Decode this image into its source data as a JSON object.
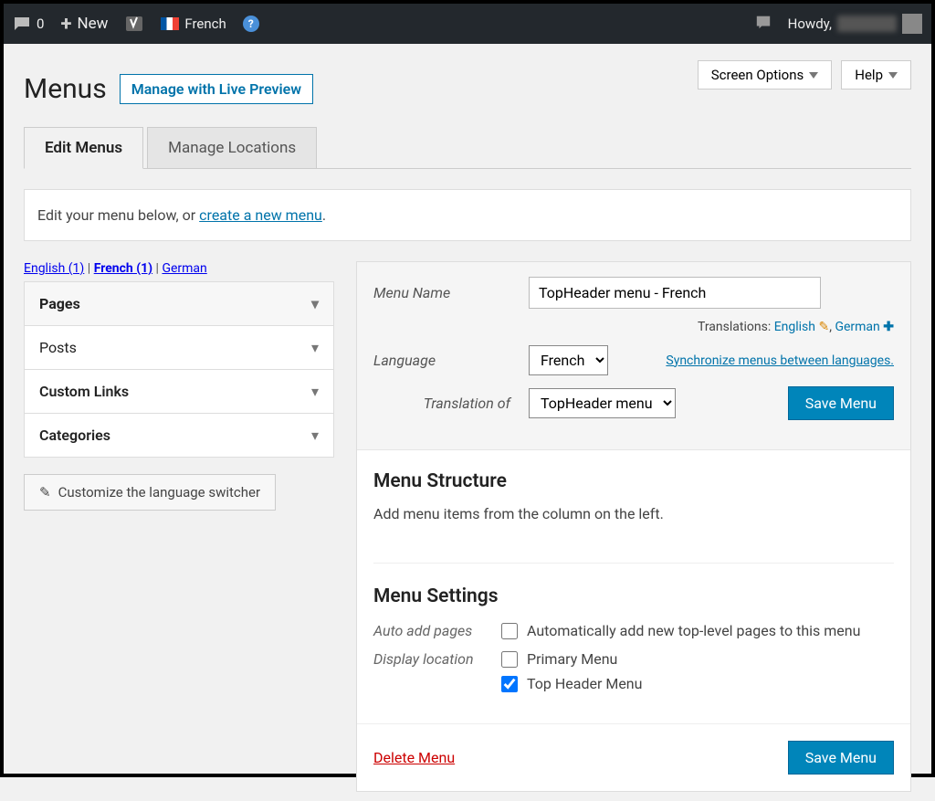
{
  "adminbar": {
    "comments_count": "0",
    "new_label": "New",
    "lang_label": "French",
    "howdy": "Howdy,"
  },
  "top_help": {
    "screen_options": "Screen Options",
    "help": "Help"
  },
  "page": {
    "title": "Menus",
    "live_preview": "Manage with Live Preview"
  },
  "tabs": {
    "edit": "Edit Menus",
    "locations": "Manage Locations"
  },
  "notice": {
    "prefix": "Edit your menu below, or ",
    "link": "create a new menu",
    "suffix": "."
  },
  "lang_filter": {
    "english": "English (1)",
    "french": "French (1)",
    "german": "German"
  },
  "accordion": {
    "pages": "Pages",
    "posts": "Posts",
    "custom_links": "Custom Links",
    "categories": "Categories"
  },
  "customize_switcher": "Customize the language switcher",
  "menu_header": {
    "menu_name_label": "Menu Name",
    "menu_name_value": "TopHeader menu - French",
    "translations_label": "Translations: ",
    "tr_english": "English",
    "tr_german": "German",
    "language_label": "Language",
    "language_value": "French",
    "sync_link": "Synchronize menus between languages.",
    "translation_of_label": "Translation of",
    "translation_of_value": "TopHeader menu",
    "save": "Save Menu"
  },
  "menu_structure": {
    "heading": "Menu Structure",
    "text": "Add menu items from the column on the left."
  },
  "menu_settings": {
    "heading": "Menu Settings",
    "auto_add_label": "Auto add pages",
    "auto_add_text": "Automatically add new top-level pages to this menu",
    "display_location_label": "Display location",
    "loc_primary": "Primary Menu",
    "loc_topheader": "Top Header Menu"
  },
  "footer": {
    "delete": "Delete Menu",
    "save": "Save Menu"
  }
}
